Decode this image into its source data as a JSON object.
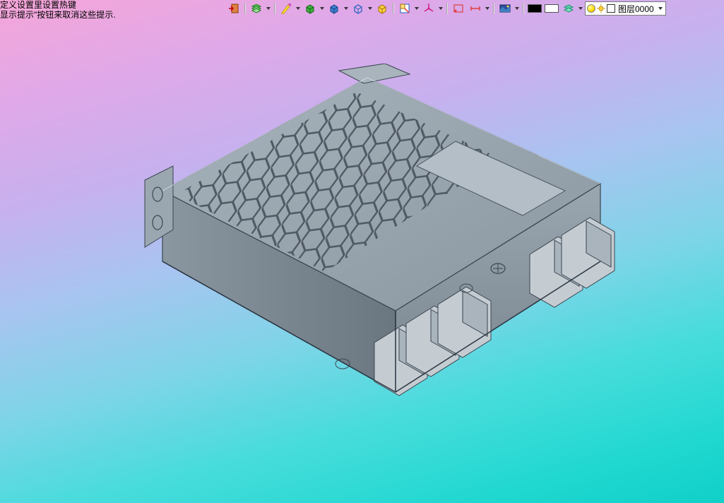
{
  "hints": {
    "line1": "定义设置里设置热键",
    "line2": "显示提示\"按钮来取消这些提示."
  },
  "toolbar": {
    "icons": {
      "import": "import-icon",
      "layers_stack": "layers-stack-icon",
      "highlighter": "highlighter-icon",
      "box_green": "box-green-icon",
      "box_blue": "box-blue-icon",
      "box_outline": "box-outline-icon",
      "isometric": "isometric-icon",
      "section": "section-icon",
      "axis": "axis-icon",
      "select_rect": "select-rect-icon",
      "measure": "measure-icon",
      "render": "render-icon",
      "black": "black-swatch",
      "white": "white-swatch",
      "layer_toggle": "layer-toggle-icon"
    }
  },
  "layer": {
    "label": "图层0000",
    "bulb_on": true,
    "color": "#ffffff"
  },
  "model": {
    "description": "3D CAD isometric wireframe of power supply enclosure with honeycomb vent pattern"
  }
}
